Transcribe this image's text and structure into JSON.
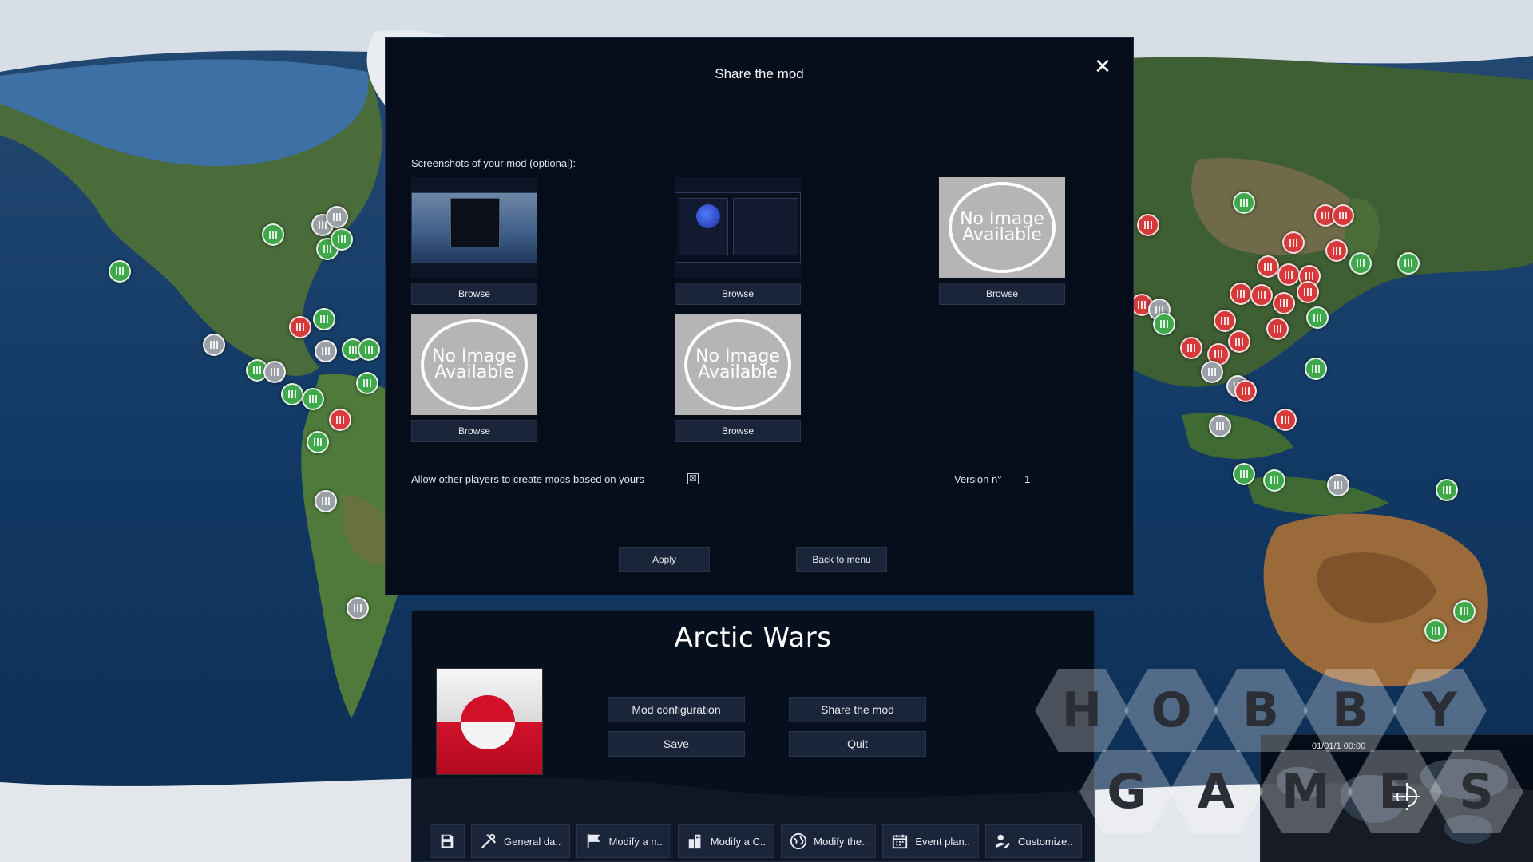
{
  "dialog": {
    "title": "Share the mod",
    "close_label": "✕",
    "screenshots_label": "Screenshots of your mod (optional):",
    "no_image_line1": "No Image",
    "no_image_line2": "Available",
    "browse_label": "Browse",
    "allow_label": "Allow other players to create mods based on yours",
    "allow_checked_glyph": "☒",
    "version_label": "Version n°",
    "version_value": "1",
    "apply_label": "Apply",
    "back_label": "Back to menu"
  },
  "panel": {
    "title": "Arctic Wars",
    "buttons": {
      "mod_configuration": "Mod configuration",
      "share_the_mod": "Share the mod",
      "save": "Save",
      "quit": "Quit"
    },
    "toolbar": [
      {
        "label": "General da..",
        "icon": "tools-icon"
      },
      {
        "label": "Modify a n..",
        "icon": "flag-icon"
      },
      {
        "label": "Modify a C..",
        "icon": "buildings-icon"
      },
      {
        "label": "Modify the..",
        "icon": "globe-icon"
      },
      {
        "label": "Event plan..",
        "icon": "calendar-icon"
      },
      {
        "label": "Customize..",
        "icon": "user-edit-icon"
      }
    ]
  },
  "minimap": {
    "date": "01/01/1 00:00"
  },
  "watermark": {
    "letters_row1": [
      "H",
      "O",
      "B",
      "B",
      "Y"
    ],
    "letters_row2": [
      "G",
      "A",
      "M",
      "E",
      "S"
    ]
  },
  "colors": {
    "modal_bg": "#050c1a",
    "button_bg": "#1a2539",
    "marker_green": "#3fa84a",
    "marker_red": "#d63a3a",
    "marker_grey": "#9aa0a6"
  }
}
